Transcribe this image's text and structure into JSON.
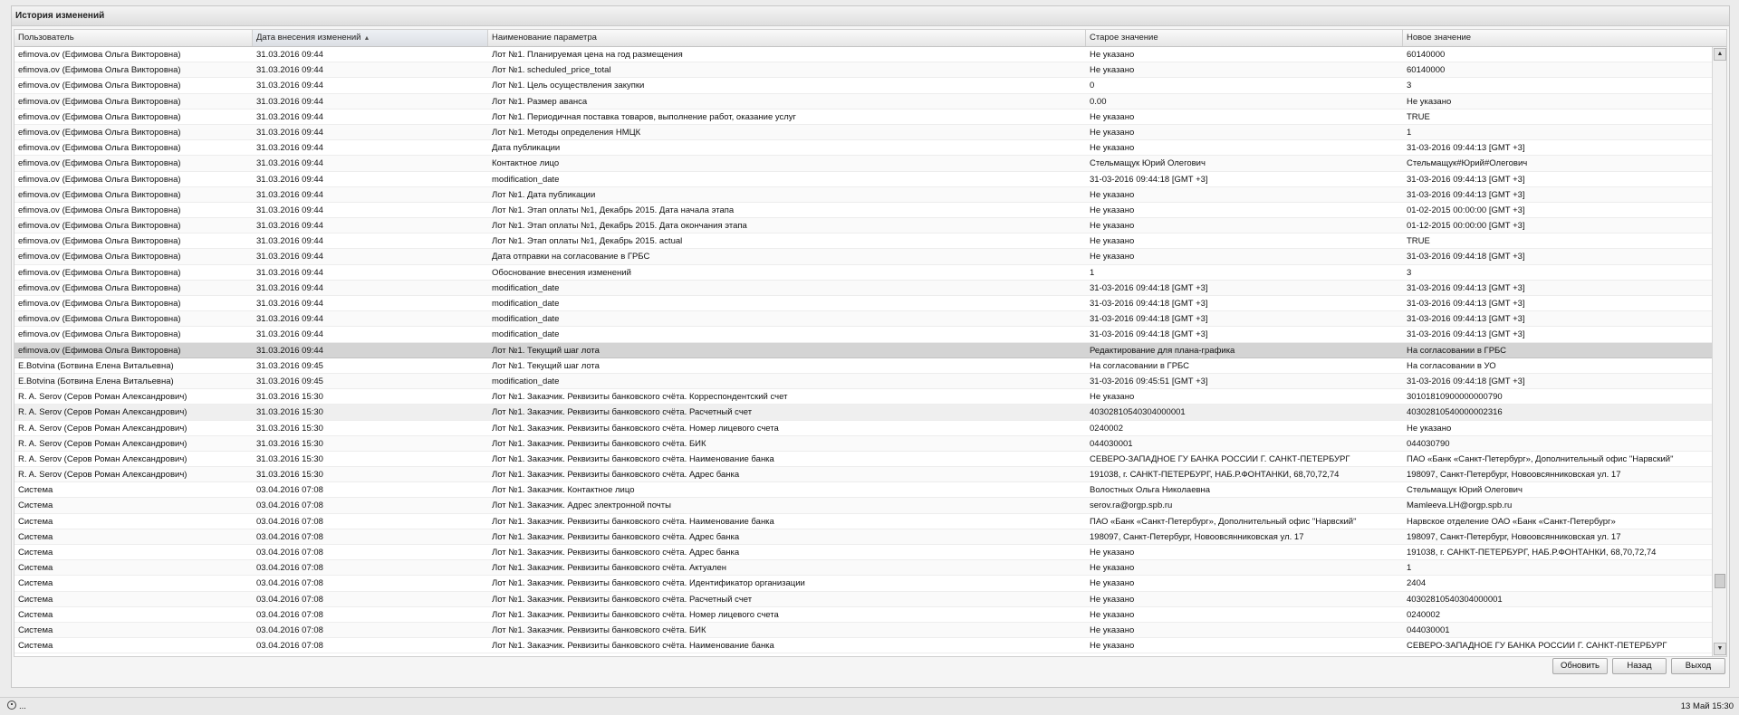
{
  "window": {
    "title": "История изменений"
  },
  "columns": [
    "Пользователь",
    "Дата внесения изменений",
    "Наименование параметра",
    "Старое значение",
    "Новое значение"
  ],
  "rows": [
    [
      "efimova.ov (Ефимова Ольга Викторовна)",
      "31.03.2016 09:44",
      "Лот №1. Планируемая цена на год размещения",
      "Не указано",
      "60140000"
    ],
    [
      "efimova.ov (Ефимова Ольга Викторовна)",
      "31.03.2016 09:44",
      "Лот №1. scheduled_price_total",
      "Не указано",
      "60140000"
    ],
    [
      "efimova.ov (Ефимова Ольга Викторовна)",
      "31.03.2016 09:44",
      "Лот №1. Цель осуществления закупки",
      "0",
      "3"
    ],
    [
      "efimova.ov (Ефимова Ольга Викторовна)",
      "31.03.2016 09:44",
      "Лот №1. Размер аванса",
      "0.00",
      "Не указано"
    ],
    [
      "efimova.ov (Ефимова Ольга Викторовна)",
      "31.03.2016 09:44",
      "Лот №1. Периодичная поставка товаров, выполнение работ, оказание услуг",
      "Не указано",
      "TRUE"
    ],
    [
      "efimova.ov (Ефимова Ольга Викторовна)",
      "31.03.2016 09:44",
      "Лот №1. Методы определения НМЦК",
      "Не указано",
      "1"
    ],
    [
      "efimova.ov (Ефимова Ольга Викторовна)",
      "31.03.2016 09:44",
      "Дата публикации",
      "Не указано",
      "31-03-2016 09:44:13 [GMT +3]"
    ],
    [
      "efimova.ov (Ефимова Ольга Викторовна)",
      "31.03.2016 09:44",
      "Контактное лицо",
      "Стельмащук Юрий Олегович",
      "Стельмащук#Юрий#Олегович"
    ],
    [
      "efimova.ov (Ефимова Ольга Викторовна)",
      "31.03.2016 09:44",
      "modification_date",
      "31-03-2016 09:44:18 [GMT +3]",
      "31-03-2016 09:44:13 [GMT +3]"
    ],
    [
      "efimova.ov (Ефимова Ольга Викторовна)",
      "31.03.2016 09:44",
      "Лот №1. Дата публикации",
      "Не указано",
      "31-03-2016 09:44:13 [GMT +3]"
    ],
    [
      "efimova.ov (Ефимова Ольга Викторовна)",
      "31.03.2016 09:44",
      "Лот №1. Этап оплаты №1, Декабрь 2015. Дата начала этапа",
      "Не указано",
      "01-02-2015 00:00:00 [GMT +3]"
    ],
    [
      "efimova.ov (Ефимова Ольга Викторовна)",
      "31.03.2016 09:44",
      "Лот №1. Этап оплаты №1, Декабрь 2015. Дата окончания этапа",
      "Не указано",
      "01-12-2015 00:00:00 [GMT +3]"
    ],
    [
      "efimova.ov (Ефимова Ольга Викторовна)",
      "31.03.2016 09:44",
      "Лот №1. Этап оплаты №1, Декабрь 2015. actual",
      "Не указано",
      "TRUE"
    ],
    [
      "efimova.ov (Ефимова Ольга Викторовна)",
      "31.03.2016 09:44",
      "Дата отправки на согласование в ГРБС",
      "Не указано",
      "31-03-2016 09:44:18 [GMT +3]"
    ],
    [
      "efimova.ov (Ефимова Ольга Викторовна)",
      "31.03.2016 09:44",
      "Обоснование внесения изменений",
      "1",
      "3"
    ],
    [
      "efimova.ov (Ефимова Ольга Викторовна)",
      "31.03.2016 09:44",
      "modification_date",
      "31-03-2016 09:44:18 [GMT +3]",
      "31-03-2016 09:44:13 [GMT +3]"
    ],
    [
      "efimova.ov (Ефимова Ольга Викторовна)",
      "31.03.2016 09:44",
      "modification_date",
      "31-03-2016 09:44:18 [GMT +3]",
      "31-03-2016 09:44:13 [GMT +3]"
    ],
    [
      "efimova.ov (Ефимова Ольга Викторовна)",
      "31.03.2016 09:44",
      "modification_date",
      "31-03-2016 09:44:18 [GMT +3]",
      "31-03-2016 09:44:13 [GMT +3]"
    ],
    [
      "efimova.ov (Ефимова Ольга Викторовна)",
      "31.03.2016 09:44",
      "modification_date",
      "31-03-2016 09:44:18 [GMT +3]",
      "31-03-2016 09:44:13 [GMT +3]"
    ],
    [
      "efimova.ov (Ефимова Ольга Викторовна)",
      "31.03.2016 09:44",
      "Лот №1. Текущий шаг лота",
      "Редактирование для плана-графика",
      "На согласовании в ГРБС"
    ],
    [
      "E.Botvina (Ботвина Елена Витальевна)",
      "31.03.2016 09:45",
      "Лот №1. Текущий шаг лота",
      "На согласовании в ГРБС",
      "На согласовании в УО"
    ],
    [
      "E.Botvina (Ботвина Елена Витальевна)",
      "31.03.2016 09:45",
      "modification_date",
      "31-03-2016 09:45:51 [GMT +3]",
      "31-03-2016 09:44:18 [GMT +3]"
    ],
    [
      "R. A. Serov (Серов Роман Александрович)",
      "31.03.2016 15:30",
      "Лот №1. Заказчик. Реквизиты банковского счёта. Корреспондентский счет",
      "Не указано",
      "30101810900000000790"
    ],
    [
      "R. A. Serov (Серов Роман Александрович)",
      "31.03.2016 15:30",
      "Лот №1. Заказчик. Реквизиты банковского счёта. Расчетный счет",
      "40302810540304000001",
      "40302810540000002316"
    ],
    [
      "R. A. Serov (Серов Роман Александрович)",
      "31.03.2016 15:30",
      "Лот №1. Заказчик. Реквизиты банковского счёта. Номер лицевого счета",
      "0240002",
      "Не указано"
    ],
    [
      "R. A. Serov (Серов Роман Александрович)",
      "31.03.2016 15:30",
      "Лот №1. Заказчик. Реквизиты банковского счёта. БИК",
      "044030001",
      "044030790"
    ],
    [
      "R. A. Serov (Серов Роман Александрович)",
      "31.03.2016 15:30",
      "Лот №1. Заказчик. Реквизиты банковского счёта. Наименование банка",
      "СЕВЕРО-ЗАПАДНОЕ ГУ БАНКА РОССИИ Г. САНКТ-ПЕТЕРБУРГ",
      "ПАО «Банк «Санкт-Петербург», Дополнительный офис \"Нарвский\""
    ],
    [
      "R. A. Serov (Серов Роман Александрович)",
      "31.03.2016 15:30",
      "Лот №1. Заказчик. Реквизиты банковского счёта. Адрес банка",
      "191038, г. САНКТ-ПЕТЕРБУРГ, НАБ.Р.ФОНТАНКИ, 68,70,72,74",
      "198097, Санкт-Петербург, Новоовсянниковская ул. 17"
    ],
    [
      "Система",
      "03.04.2016 07:08",
      "Лот №1. Заказчик. Контактное лицо",
      "Волостных Ольга Николаевна",
      "Стельмащук Юрий Олегович"
    ],
    [
      "Система",
      "03.04.2016 07:08",
      "Лот №1. Заказчик. Адрес электронной почты",
      "serov.ra@orgp.spb.ru",
      "Mamleeva.LH@orgp.spb.ru"
    ],
    [
      "Система",
      "03.04.2016 07:08",
      "Лот №1. Заказчик. Реквизиты банковского счёта. Наименование банка",
      "ПАО «Банк «Санкт-Петербург», Дополнительный офис \"Нарвский\"",
      "Нарвское отделение ОАО «Банк «Санкт-Петербург»"
    ],
    [
      "Система",
      "03.04.2016 07:08",
      "Лот №1. Заказчик. Реквизиты банковского счёта. Адрес банка",
      "198097, Санкт-Петербург, Новоовсянниковская ул. 17",
      "198097, Санкт-Петербург, Новоовсянниковская ул. 17"
    ],
    [
      "Система",
      "03.04.2016 07:08",
      "Лот №1. Заказчик. Реквизиты банковского счёта. Адрес банка",
      "Не указано",
      "191038, г. САНКТ-ПЕТЕРБУРГ, НАБ.Р.ФОНТАНКИ, 68,70,72,74"
    ],
    [
      "Система",
      "03.04.2016 07:08",
      "Лот №1. Заказчик. Реквизиты банковского счёта. Актуален",
      "Не указано",
      "1"
    ],
    [
      "Система",
      "03.04.2016 07:08",
      "Лот №1. Заказчик. Реквизиты банковского счёта. Идентификатор организации",
      "Не указано",
      "2404"
    ],
    [
      "Система",
      "03.04.2016 07:08",
      "Лот №1. Заказчик. Реквизиты банковского счёта. Расчетный счет",
      "Не указано",
      "40302810540304000001"
    ],
    [
      "Система",
      "03.04.2016 07:08",
      "Лот №1. Заказчик. Реквизиты банковского счёта. Номер лицевого счета",
      "Не указано",
      "0240002"
    ],
    [
      "Система",
      "03.04.2016 07:08",
      "Лот №1. Заказчик. Реквизиты банковского счёта. БИК",
      "Не указано",
      "044030001"
    ],
    [
      "Система",
      "03.04.2016 07:08",
      "Лот №1. Заказчик. Реквизиты банковского счёта. Наименование банка",
      "Не указано",
      "СЕВЕРО-ЗАПАДНОЕ ГУ БАНКА РОССИИ Г. САНКТ-ПЕТЕРБУРГ"
    ]
  ],
  "selected_row": 19,
  "hover_row": 23,
  "buttons": {
    "refresh": "Обновить",
    "back": "Назад",
    "exit": "Выход"
  },
  "status": {
    "left": "...",
    "right": "13 Май 15:30"
  },
  "icons": {
    "sort": "sort-asc-icon",
    "scroll_up": "arrow-up-icon",
    "scroll_down": "arrow-down-icon",
    "status": "info-circle-icon"
  }
}
